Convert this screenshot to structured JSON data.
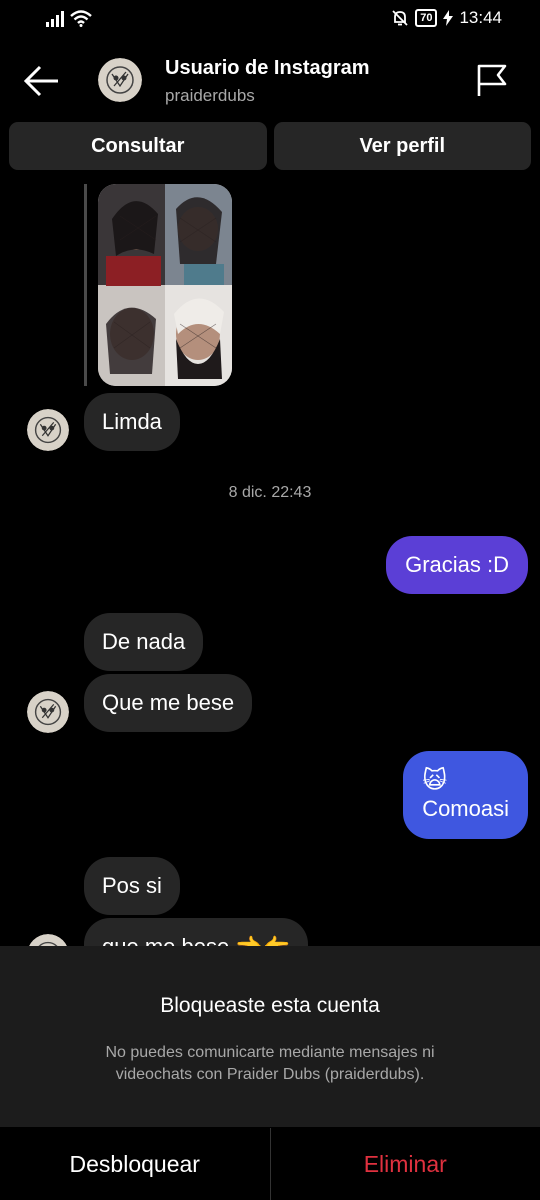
{
  "status_bar": {
    "time": "13:44",
    "battery": "70"
  },
  "header": {
    "name": "Usuario de Instagram",
    "username": "praiderdubs",
    "consult_label": "Consultar",
    "profile_label": "Ver perfil"
  },
  "messages": {
    "limda": "Limda",
    "timestamp": "8 dic. 22:43",
    "gracias": "Gracias :D",
    "de_nada": "De nada",
    "que_me_bese": "Que me bese",
    "comoasi_emoji": "🙀",
    "comoasi": "Comoasi",
    "pos_si": "Pos si",
    "que_me_bese_2": "que me bese 👈👉"
  },
  "blocked": {
    "title": "Bloqueaste esta cuenta",
    "description": "No puedes comunicarte mediante mensajes ni videochats con Praider Dubs (praiderdubs).",
    "unblock_label": "Desbloquear",
    "delete_label": "Eliminar"
  },
  "colors": {
    "outgoing_1": "#5b3fd6",
    "outgoing_2": "#3f57e0",
    "delete": "#e0313f",
    "incoming": "#262626"
  }
}
